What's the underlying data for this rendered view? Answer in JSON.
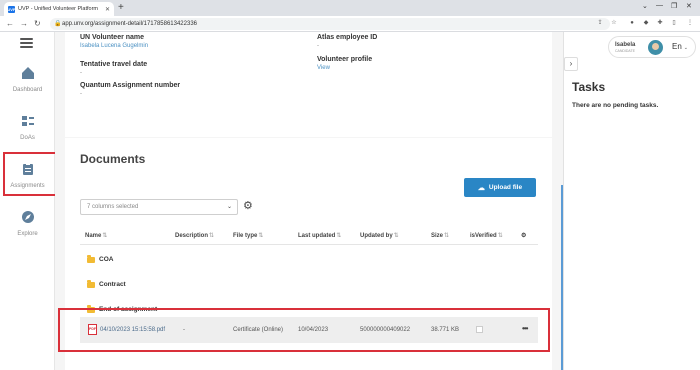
{
  "browser": {
    "tab_icon_text": "UVP",
    "tab_title": "UVP - Unified Volunteer Platform",
    "url": "app.unv.org/assignment-detail/1717858613422336"
  },
  "nav": {
    "items": [
      {
        "label": "Dashboard"
      },
      {
        "label": "DoAs"
      },
      {
        "label": "Assignments"
      },
      {
        "label": "Explore"
      }
    ]
  },
  "details": {
    "un_volunteer_label": "UN Volunteer name",
    "un_volunteer_value": "Isabela Lucena Gugelmin",
    "atlas_label": "Atlas employee ID",
    "atlas_value": "-",
    "travel_label": "Tentative travel date",
    "travel_value": "-",
    "profile_label": "Volunteer profile",
    "profile_link": "View",
    "quantum_label": "Quantum Assignment number",
    "quantum_value": "-"
  },
  "documents": {
    "title": "Documents",
    "upload_label": "Upload file",
    "columns_selected": "7 columns selected",
    "columns": [
      "Name",
      "Description",
      "File type",
      "Last updated",
      "Updated by",
      "Size",
      "isVerified"
    ],
    "folders": [
      "COA",
      "Contract",
      "End of assignment"
    ],
    "file": {
      "icon_text": "PDF",
      "name": "04/10/2023 15:15:58.pdf",
      "description": "-",
      "file_type": "Certificate (Online)",
      "last_updated": "10/04/2023",
      "updated_by": "500000000409022",
      "size": "38.771 KB",
      "more": "•••"
    }
  },
  "user": {
    "name": "Isabela",
    "role": "CANDIDATE",
    "language": "En"
  },
  "tasks": {
    "title": "Tasks",
    "empty": "There are no pending tasks."
  },
  "colors": {
    "accent": "#2a86c5",
    "highlight": "#d9303a",
    "folder": "#f2bb34"
  }
}
